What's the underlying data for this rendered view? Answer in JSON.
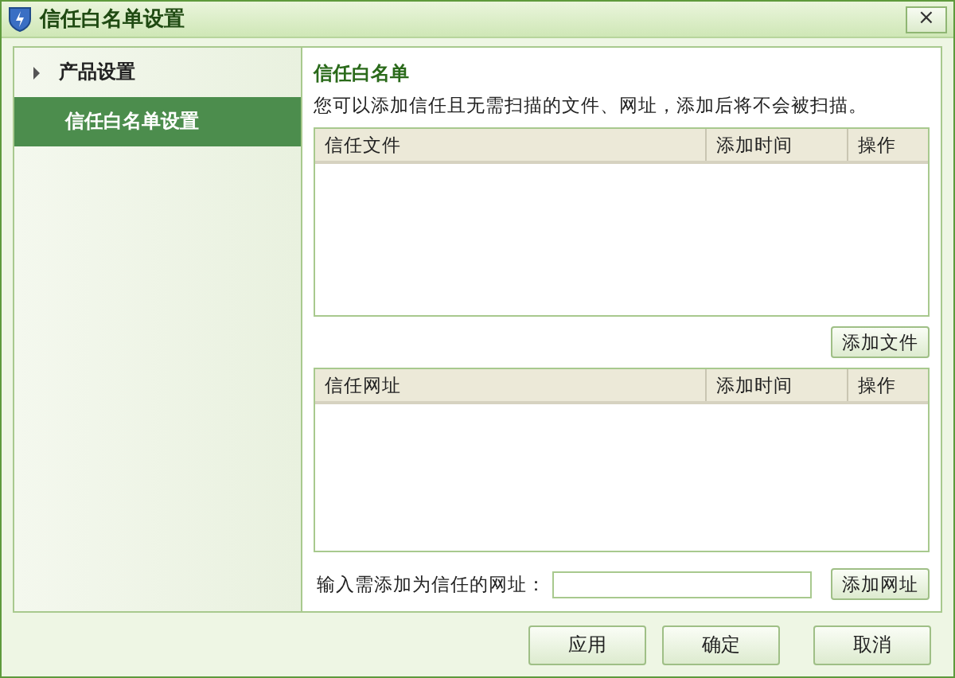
{
  "window": {
    "title": "信任白名单设置",
    "close": "×"
  },
  "sidebar": {
    "items": [
      {
        "label": "产品设置",
        "kind": "group",
        "selected": false
      },
      {
        "label": "信任白名单设置",
        "kind": "page",
        "selected": true
      }
    ]
  },
  "section": {
    "title": "信任白名单",
    "description": "您可以添加信任且无需扫描的文件、网址，添加后将不会被扫描。"
  },
  "file_table": {
    "columns": [
      "信任文件",
      "添加时间",
      "操作"
    ]
  },
  "add_file_button": "添加文件",
  "url_table": {
    "columns": [
      "信任网址",
      "添加时间",
      "操作"
    ]
  },
  "url_input": {
    "label": "输入需添加为信任的网址："
  },
  "add_url_button": "添加网址",
  "buttons": [
    "应用",
    "确定",
    "取消"
  ]
}
